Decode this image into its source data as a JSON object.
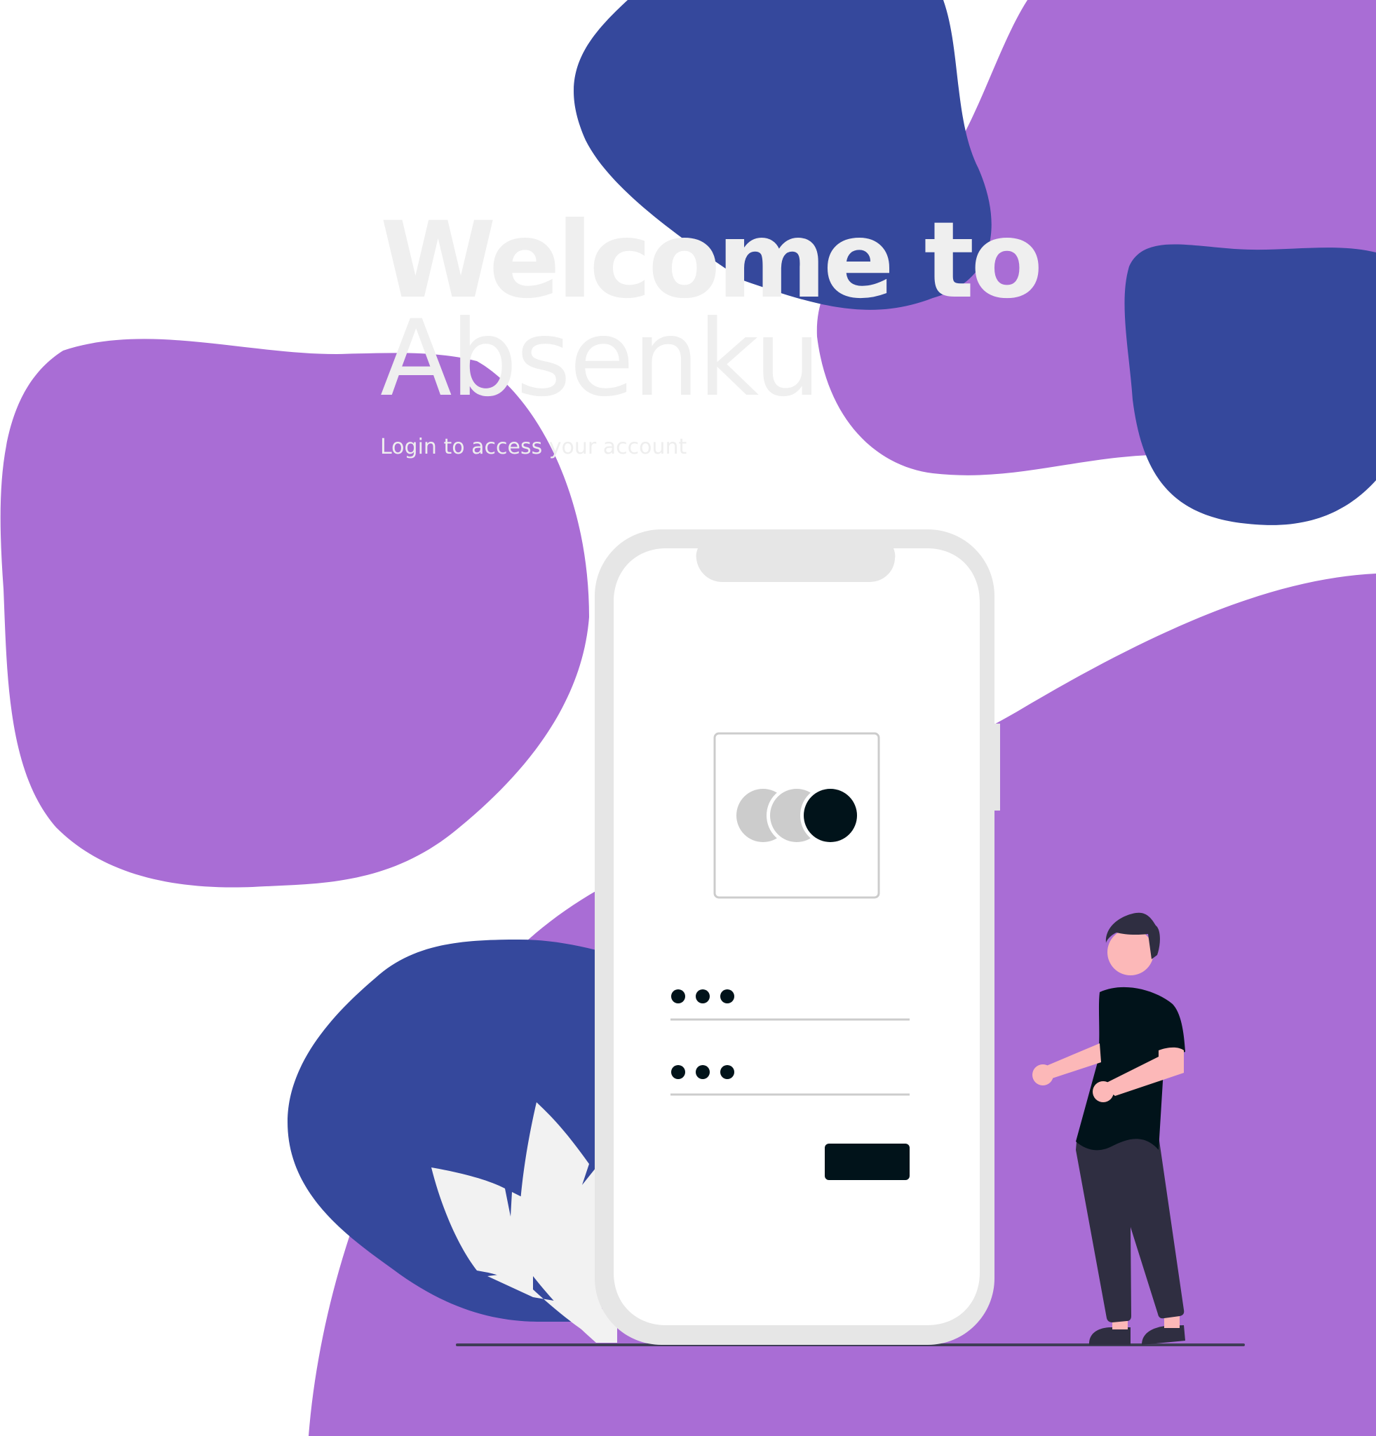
{
  "welcome": {
    "title_line1": "Welcome to",
    "title_line2": "Absenku",
    "subtitle": "Login to access your account"
  },
  "colors": {
    "purple": "#a96dd5",
    "navy": "#35489c",
    "phone_frame": "#e6e6e6",
    "dark": "#01131a",
    "pants": "#2f2e41",
    "skin": "#fcb8b8",
    "leaf": "#f2f2f2",
    "heading_text": "#efefef"
  },
  "icons": {
    "logo": "overlapping-circles-logo-icon",
    "password_mask": "password-dots-icon"
  }
}
